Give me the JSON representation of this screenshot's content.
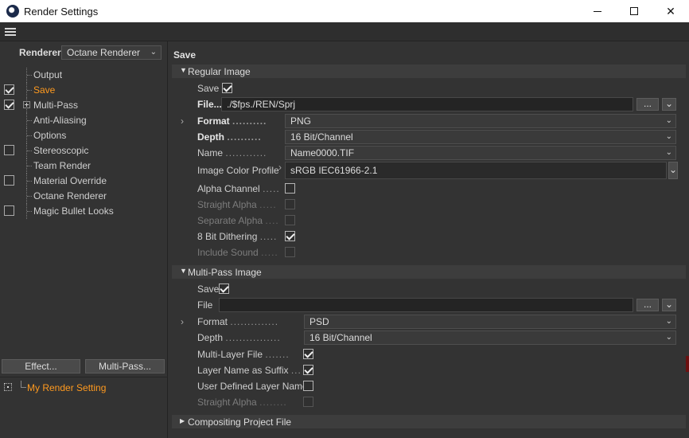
{
  "window": {
    "title": "Render Settings",
    "minimize_glyph": "",
    "close_glyph": "✕"
  },
  "left": {
    "renderer_label": "Renderer",
    "renderer_value": "Octane Renderer",
    "tree": [
      {
        "label": "Output",
        "has_checkbox": false,
        "checked": false,
        "active": false
      },
      {
        "label": "Save",
        "has_checkbox": true,
        "checked": true,
        "active": true
      },
      {
        "label": "Multi-Pass",
        "has_checkbox": true,
        "checked": true,
        "active": false,
        "expandable": true
      },
      {
        "label": "Anti-Aliasing",
        "has_checkbox": false,
        "checked": false,
        "active": false
      },
      {
        "label": "Options",
        "has_checkbox": false,
        "checked": false,
        "active": false
      },
      {
        "label": "Stereoscopic",
        "has_checkbox": true,
        "checked": false,
        "active": false
      },
      {
        "label": "Team Render",
        "has_checkbox": false,
        "checked": false,
        "active": false
      },
      {
        "label": "Material Override",
        "has_checkbox": true,
        "checked": false,
        "active": false
      },
      {
        "label": "Octane Renderer",
        "has_checkbox": false,
        "checked": false,
        "active": false
      },
      {
        "label": "Magic Bullet Looks",
        "has_checkbox": true,
        "checked": false,
        "active": false
      }
    ],
    "effect_button": "Effect...",
    "multipass_button": "Multi-Pass...",
    "setting_name": "My Render Setting"
  },
  "right": {
    "title": "Save",
    "regular": {
      "header": "Regular Image",
      "save_label": "Save",
      "save_checked": true,
      "file_label": "File...",
      "file_value": "./$fps./REN/Sprj",
      "browse_label": "...",
      "format_label": "Format",
      "format_value": "PNG",
      "depth_label": "Depth",
      "depth_value": "16 Bit/Channel",
      "name_label": "Name",
      "name_value": "Name0000.TIF",
      "profile_label": "Image Color Profile",
      "profile_value": "sRGB IEC61966-2.1",
      "alpha_label": "Alpha Channel",
      "alpha_checked": false,
      "straight_label": "Straight Alpha",
      "separate_label": "Separate Alpha",
      "dither_label": "8 Bit Dithering",
      "dither_checked": true,
      "sound_label": "Include Sound"
    },
    "multipass": {
      "header": "Multi-Pass Image",
      "save_label": "Save",
      "save_checked": true,
      "file_label": "File",
      "file_value": "",
      "browse_label": "...",
      "format_label": "Format",
      "format_value": "PSD",
      "depth_label": "Depth",
      "depth_value": "16 Bit/Channel",
      "multilayer_label": "Multi-Layer File",
      "multilayer_checked": true,
      "suffix_label": "Layer Name as Suffix",
      "suffix_checked": true,
      "userdefined_label": "User Defined Layer Name",
      "userdefined_checked": false,
      "straight_label": "Straight Alpha"
    },
    "compositing": {
      "header": "Compositing Project File"
    }
  },
  "colors": {
    "accent": "#ff9a1f",
    "panel": "#333333",
    "field": "#242424"
  }
}
